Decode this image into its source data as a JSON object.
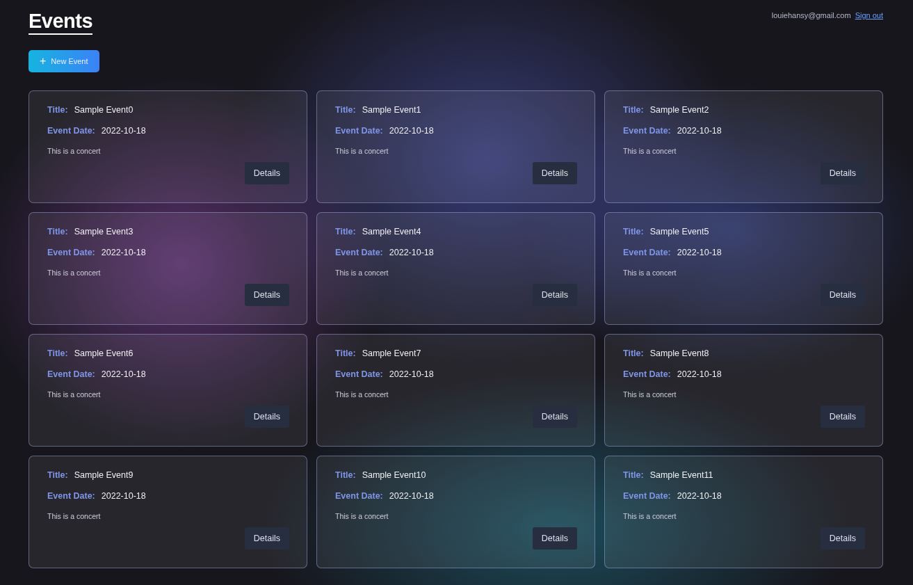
{
  "header": {
    "title": "Events",
    "email": "louiehansy@gmail.com",
    "sign_out": "Sign out"
  },
  "new_event_button": {
    "icon": "+",
    "label": "New Event"
  },
  "events": [
    {
      "title_label": "Title:",
      "title": "Sample Event0",
      "date_label": "Event Date:",
      "date": "2022-10-18",
      "description": "This is a concert",
      "button": "Details"
    },
    {
      "title_label": "Title:",
      "title": "Sample Event1",
      "date_label": "Event Date:",
      "date": "2022-10-18",
      "description": "This is a concert",
      "button": "Details"
    },
    {
      "title_label": "Title:",
      "title": "Sample Event2",
      "date_label": "Event Date:",
      "date": "2022-10-18",
      "description": "This is a concert",
      "button": "Details"
    },
    {
      "title_label": "Title:",
      "title": "Sample Event3",
      "date_label": "Event Date:",
      "date": "2022-10-18",
      "description": "This is a concert",
      "button": "Details"
    },
    {
      "title_label": "Title:",
      "title": "Sample Event4",
      "date_label": "Event Date:",
      "date": "2022-10-18",
      "description": "This is a concert",
      "button": "Details"
    },
    {
      "title_label": "Title:",
      "title": "Sample Event5",
      "date_label": "Event Date:",
      "date": "2022-10-18",
      "description": "This is a concert",
      "button": "Details"
    },
    {
      "title_label": "Title:",
      "title": "Sample Event6",
      "date_label": "Event Date:",
      "date": "2022-10-18",
      "description": "This is a concert",
      "button": "Details"
    },
    {
      "title_label": "Title:",
      "title": "Sample Event7",
      "date_label": "Event Date:",
      "date": "2022-10-18",
      "description": "This is a concert",
      "button": "Details"
    },
    {
      "title_label": "Title:",
      "title": "Sample Event8",
      "date_label": "Event Date:",
      "date": "2022-10-18",
      "description": "This is a concert",
      "button": "Details"
    },
    {
      "title_label": "Title:",
      "title": "Sample Event9",
      "date_label": "Event Date:",
      "date": "2022-10-18",
      "description": "This is a concert",
      "button": "Details"
    },
    {
      "title_label": "Title:",
      "title": "Sample Event10",
      "date_label": "Event Date:",
      "date": "2022-10-18",
      "description": "This is a concert",
      "button": "Details"
    },
    {
      "title_label": "Title:",
      "title": "Sample Event11",
      "date_label": "Event Date:",
      "date": "2022-10-18",
      "description": "This is a concert",
      "button": "Details"
    }
  ]
}
